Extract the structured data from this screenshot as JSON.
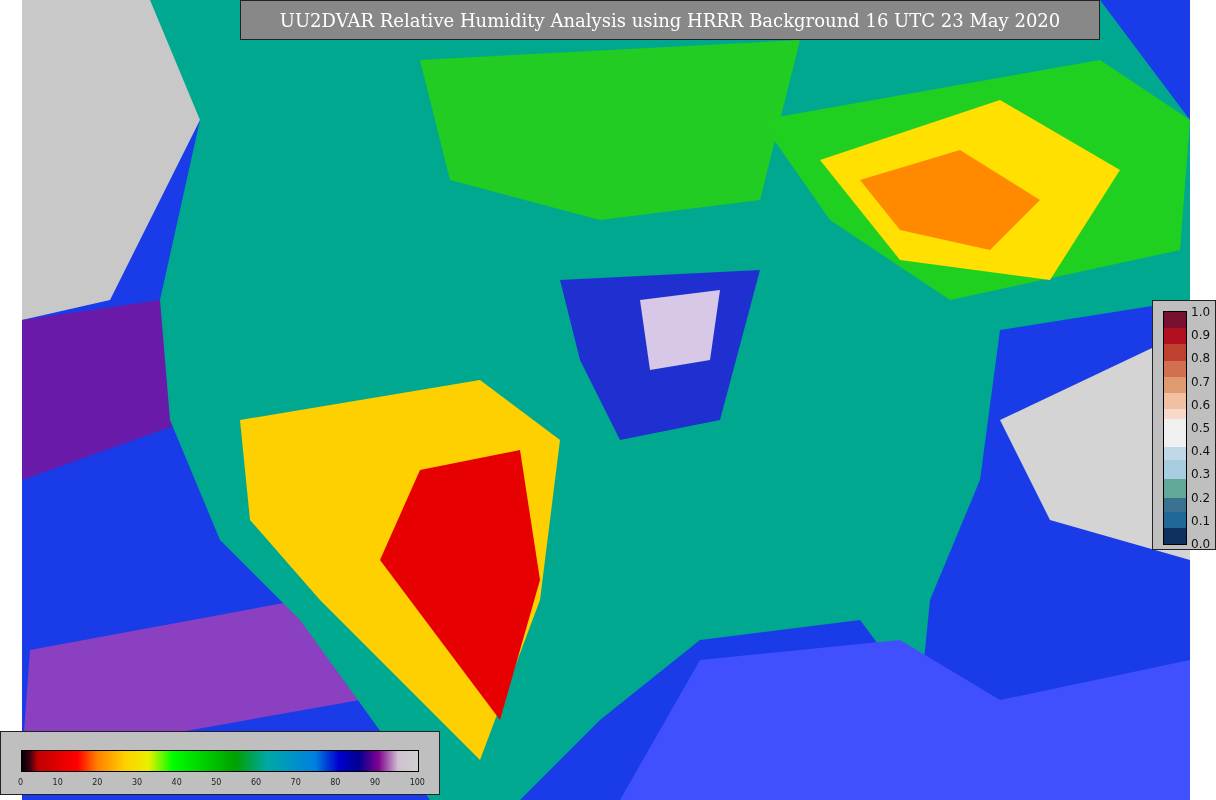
{
  "title": "UU2DVAR Relative Humidity Analysis using HRRR Background 16 UTC 23 May 2020",
  "humidity_colorbar": {
    "ticks": [
      "0",
      "10",
      "20",
      "30",
      "40",
      "50",
      "60",
      "70",
      "80",
      "90",
      "100"
    ]
  },
  "station_colorbar": {
    "ticks": [
      "1.0",
      "0.9",
      "0.8",
      "0.7",
      "0.6",
      "0.5",
      "0.4",
      "0.3",
      "0.2",
      "0.1",
      "0.0"
    ]
  }
}
